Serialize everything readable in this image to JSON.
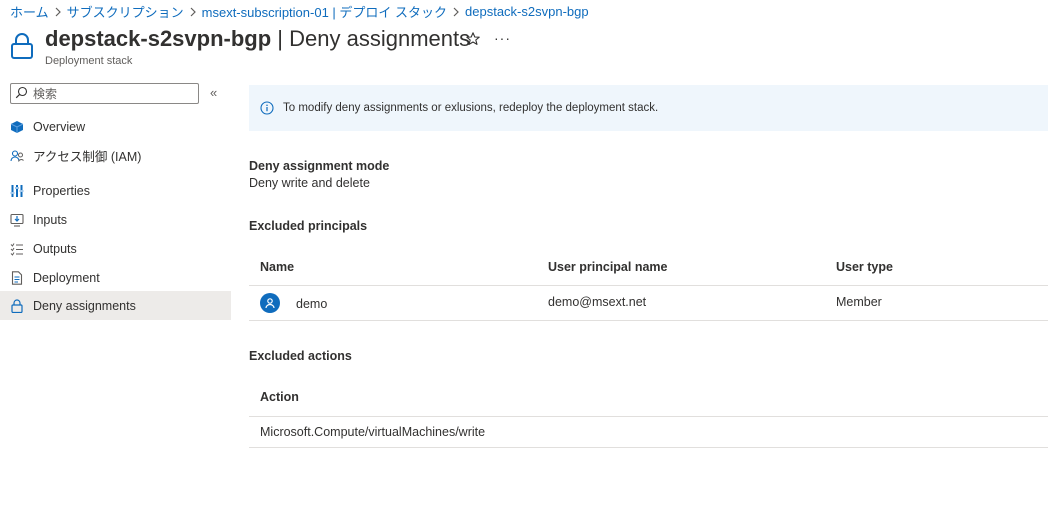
{
  "breadcrumb": {
    "items": [
      {
        "label": "ホーム"
      },
      {
        "label": "サブスクリプション"
      },
      {
        "label": "msext-subscription-01 | デプロイ スタック"
      },
      {
        "label": "depstack-s2svpn-bgp"
      }
    ]
  },
  "header": {
    "resource_name": "depstack-s2svpn-bgp",
    "separator": "|",
    "page_name": "Deny assignments",
    "subtitle": "Deployment stack",
    "more_label": "···"
  },
  "sidebar": {
    "search_placeholder": "検索",
    "collapse_label": "«",
    "items": [
      {
        "label": "Overview",
        "icon": "cube-icon"
      },
      {
        "label": "アクセス制御 (IAM)",
        "icon": "people-icon"
      },
      {
        "label": "Properties",
        "icon": "properties-icon"
      },
      {
        "label": "Inputs",
        "icon": "inputs-icon"
      },
      {
        "label": "Outputs",
        "icon": "outputs-icon"
      },
      {
        "label": "Deployment",
        "icon": "document-icon"
      },
      {
        "label": "Deny assignments",
        "icon": "lock-icon",
        "active": true
      }
    ]
  },
  "banner": {
    "text": "To modify deny assignments or exlusions, redeploy the deployment stack."
  },
  "mode": {
    "label": "Deny assignment mode",
    "value": "Deny write and delete"
  },
  "principals": {
    "label": "Excluded principals",
    "columns": [
      "Name",
      "User principal name",
      "User type"
    ],
    "rows": [
      {
        "name": "demo",
        "upn": "demo@msext.net",
        "type": "Member"
      }
    ]
  },
  "actions": {
    "label": "Excluded actions",
    "columns": [
      "Action"
    ],
    "rows": [
      {
        "action": "Microsoft.Compute/virtualMachines/write"
      }
    ]
  },
  "colors": {
    "accent": "#0f6cbd",
    "banner_bg": "#eff6fc",
    "active_nav_bg": "#edebe9",
    "text": "#323130"
  }
}
